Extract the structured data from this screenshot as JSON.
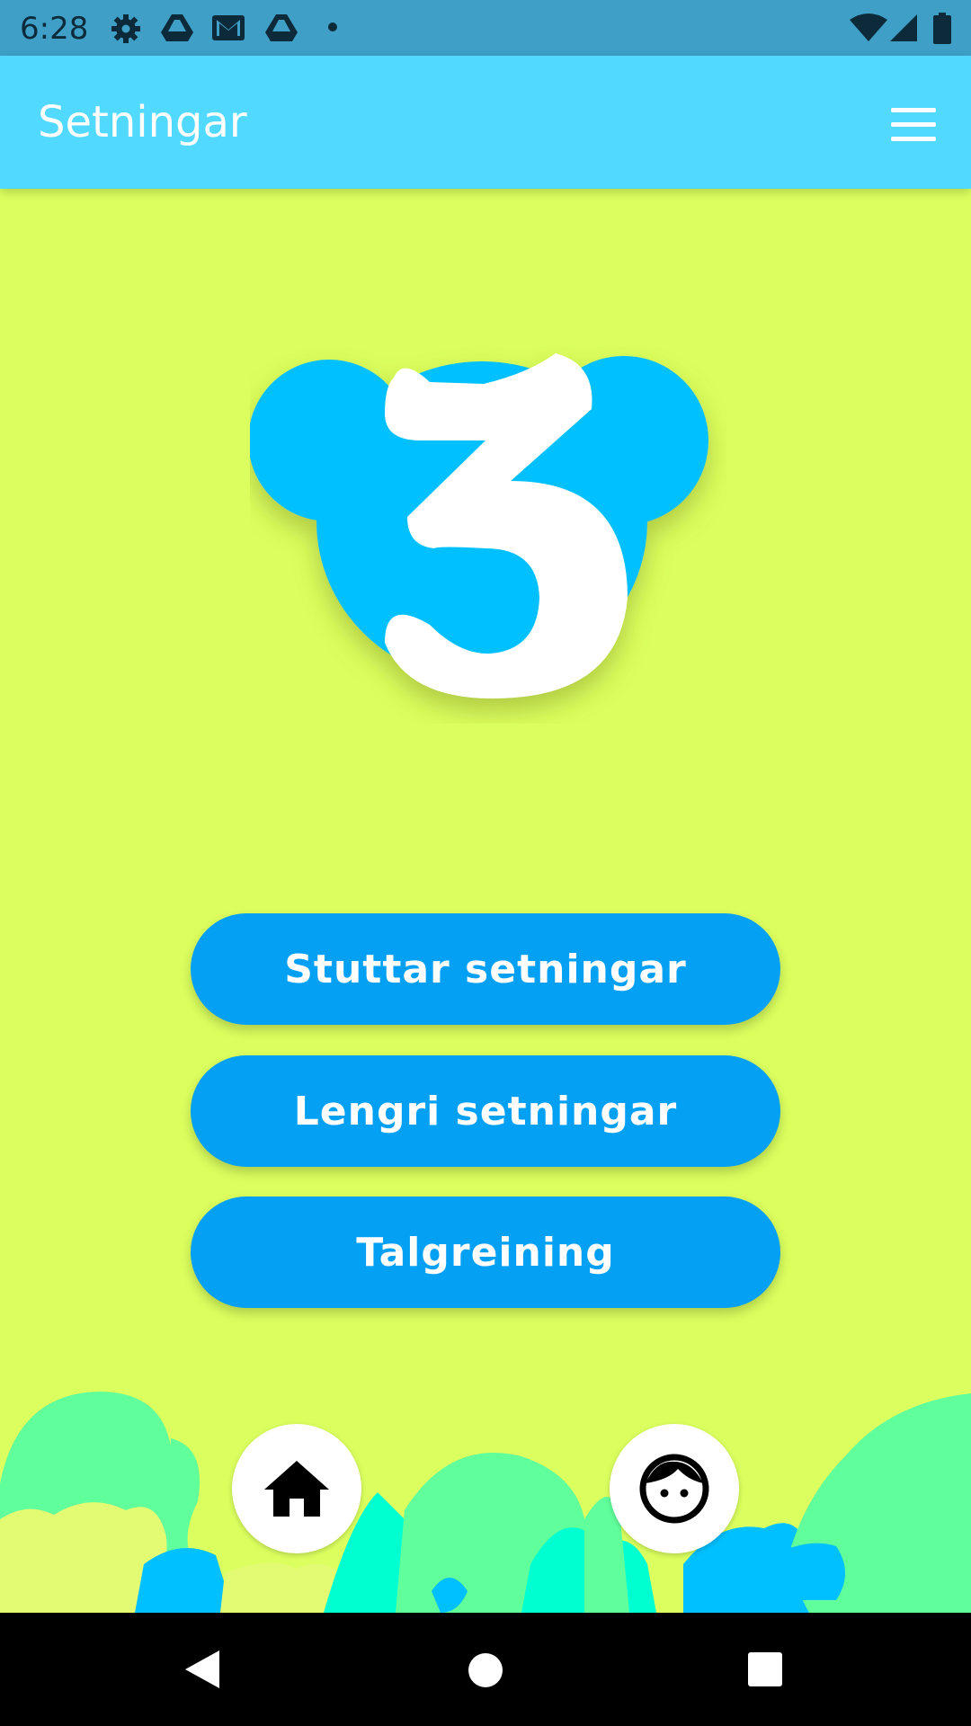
{
  "status_bar": {
    "time": "6:28",
    "icons": [
      "settings-icon",
      "drive-icon",
      "gmail-icon",
      "drive-icon",
      "dot-icon",
      "wifi-icon",
      "signal-icon",
      "battery-icon"
    ]
  },
  "app_bar": {
    "title": "Setningar",
    "menu_icon": "hamburger-menu-icon"
  },
  "logo": {
    "glyph": "3",
    "colors": {
      "ears": "#00c0ff",
      "number": "#ffffff"
    }
  },
  "buttons": {
    "short_sentences": "Stuttar setningar",
    "longer_sentences": "Lengri setningar",
    "number_analysis": "Talgreining"
  },
  "bottom_bar": {
    "home_icon": "home-icon",
    "profile_icon": "face-icon"
  },
  "nav_bar": {
    "icons": [
      "back-icon",
      "home-circle-icon",
      "recents-square-icon"
    ]
  },
  "colors": {
    "background": "#dbff5e",
    "app_bar": "#52d9ff",
    "status_bar": "#3f9fc6",
    "button": "#03a0f4",
    "button_text": "#ffffff"
  }
}
